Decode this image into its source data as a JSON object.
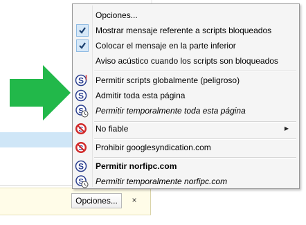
{
  "menu": {
    "items": [
      {
        "label": "Opciones...",
        "icon": null,
        "checked": false
      },
      {
        "label": "Mostrar mensaje referente a scripts bloqueados",
        "icon": "checkmark-icon",
        "checked": true
      },
      {
        "label": "Colocar el mensaje en la parte inferior",
        "icon": "checkmark-icon",
        "checked": true
      },
      {
        "label": "Aviso acústico cuando los scripts son bloqueados",
        "icon": null,
        "checked": false
      },
      {
        "label": "Permitir scripts globalmente (peligroso)",
        "icon": "noscript-allow-global-icon"
      },
      {
        "label": "Admitir toda esta página",
        "icon": "noscript-allow-icon"
      },
      {
        "label": "Permitir temporalmente toda esta página",
        "icon": "noscript-temp-allow-icon",
        "italic": true
      },
      {
        "label": "No fiable",
        "icon": "noscript-untrusted-icon",
        "submenu": true
      },
      {
        "label": "Prohibir googlesyndication.com",
        "icon": "noscript-forbid-icon"
      },
      {
        "label": "Permitir norfipc.com",
        "icon": "noscript-allow-icon",
        "bold": true
      },
      {
        "label": "Permitir temporalmente norfipc.com",
        "icon": "noscript-temp-allow-icon",
        "italic": true
      }
    ]
  },
  "notification": {
    "options_button_label": "Opciones...",
    "close_label": "×"
  },
  "colors": {
    "arrow": "#22b84a",
    "noscript_blue": "#2b3f8f",
    "noscript_red": "#d12a2a",
    "check": "#1a3e6e"
  }
}
